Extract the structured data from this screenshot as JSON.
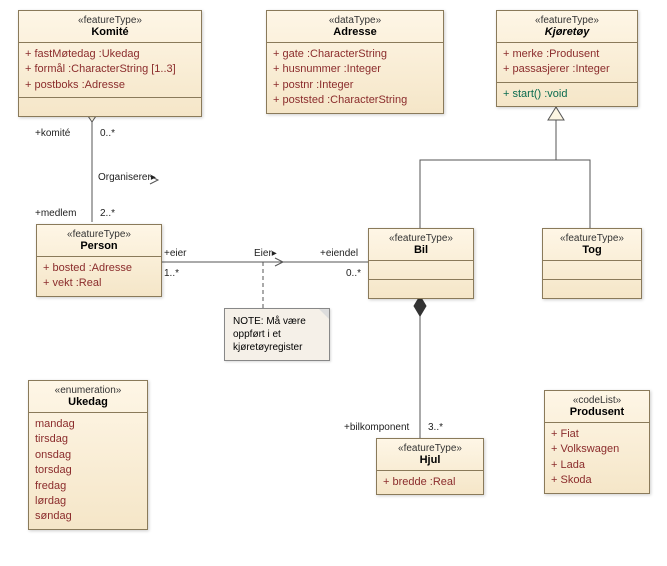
{
  "classes": {
    "komite": {
      "stereo": "«featureType»",
      "name": "Komité",
      "attrs": [
        "+  fastMøtedag :Ukedag",
        "+  formål :CharacterString [1..3]",
        "+  postboks :Adresse"
      ]
    },
    "adresse": {
      "stereo": "«dataType»",
      "name": "Adresse",
      "attrs": [
        "+  gate :CharacterString",
        "+  husnummer :Integer",
        "+  postnr :Integer",
        "+  poststed :CharacterString"
      ]
    },
    "kjoretoy": {
      "stereo": "«featureType»",
      "name": "Kjøretøy",
      "attrs": [
        "+  merke :Produsent",
        "+  passasjerer :Integer"
      ],
      "ops": [
        "+  start() :void"
      ]
    },
    "person": {
      "stereo": "«featureType»",
      "name": "Person",
      "attrs": [
        "+  bosted :Adresse",
        "+  vekt :Real"
      ]
    },
    "bil": {
      "stereo": "«featureType»",
      "name": "Bil"
    },
    "tog": {
      "stereo": "«featureType»",
      "name": "Tog"
    },
    "hjul": {
      "stereo": "«featureType»",
      "name": "Hjul",
      "attrs": [
        "+  bredde :Real"
      ]
    },
    "ukedag": {
      "stereo": "«enumeration»",
      "name": "Ukedag",
      "literals": [
        "mandag",
        "tirsdag",
        "onsdag",
        "torsdag",
        "fredag",
        "lørdag",
        "søndag"
      ]
    },
    "produsent": {
      "stereo": "«codeList»",
      "name": "Produsent",
      "attrs": [
        "+  Fiat",
        "+  Volkswagen",
        "+  Lada",
        "+  Skoda"
      ]
    }
  },
  "labels": {
    "komite_role": "+komité",
    "komite_mult": "0..*",
    "organiserer": "Organiserer",
    "medlem_role": "+medlem",
    "medlem_mult": "2..*",
    "eier_role": "+eier",
    "eier_mult": "1..*",
    "eier_assoc": "Eier",
    "eiendel_role": "+eiendel",
    "eiendel_mult": "0..*",
    "bilkomp_role": "+bilkomponent",
    "bilkomp_mult": "3..*"
  },
  "note": {
    "text": "NOTE: Må være oppført i et kjøretøyregister"
  },
  "chart_data": {
    "type": "uml_class_diagram",
    "classes": [
      {
        "name": "Komité",
        "stereotype": "featureType",
        "attributes": [
          {
            "name": "fastMøtedag",
            "type": "Ukedag",
            "visibility": "+"
          },
          {
            "name": "formål",
            "type": "CharacterString",
            "multiplicity": "1..3",
            "visibility": "+"
          },
          {
            "name": "postboks",
            "type": "Adresse",
            "visibility": "+"
          }
        ]
      },
      {
        "name": "Adresse",
        "stereotype": "dataType",
        "attributes": [
          {
            "name": "gate",
            "type": "CharacterString",
            "visibility": "+"
          },
          {
            "name": "husnummer",
            "type": "Integer",
            "visibility": "+"
          },
          {
            "name": "postnr",
            "type": "Integer",
            "visibility": "+"
          },
          {
            "name": "poststed",
            "type": "CharacterString",
            "visibility": "+"
          }
        ]
      },
      {
        "name": "Kjøretøy",
        "stereotype": "featureType",
        "abstract": true,
        "attributes": [
          {
            "name": "merke",
            "type": "Produsent",
            "visibility": "+"
          },
          {
            "name": "passasjerer",
            "type": "Integer",
            "visibility": "+"
          }
        ],
        "operations": [
          {
            "name": "start",
            "returns": "void",
            "visibility": "+"
          }
        ]
      },
      {
        "name": "Person",
        "stereotype": "featureType",
        "attributes": [
          {
            "name": "bosted",
            "type": "Adresse",
            "visibility": "+"
          },
          {
            "name": "vekt",
            "type": "Real",
            "visibility": "+"
          }
        ]
      },
      {
        "name": "Bil",
        "stereotype": "featureType"
      },
      {
        "name": "Tog",
        "stereotype": "featureType"
      },
      {
        "name": "Hjul",
        "stereotype": "featureType",
        "attributes": [
          {
            "name": "bredde",
            "type": "Real",
            "visibility": "+"
          }
        ]
      },
      {
        "name": "Ukedag",
        "stereotype": "enumeration",
        "literals": [
          "mandag",
          "tirsdag",
          "onsdag",
          "torsdag",
          "fredag",
          "lørdag",
          "søndag"
        ]
      },
      {
        "name": "Produsent",
        "stereotype": "codeList",
        "attributes": [
          {
            "name": "Fiat",
            "visibility": "+"
          },
          {
            "name": "Volkswagen",
            "visibility": "+"
          },
          {
            "name": "Lada",
            "visibility": "+"
          },
          {
            "name": "Skoda",
            "visibility": "+"
          }
        ]
      }
    ],
    "relationships": [
      {
        "type": "aggregation",
        "whole": "Komité",
        "part": "Person",
        "name": "Organiserer",
        "ends": [
          {
            "role": "komité",
            "multiplicity": "0..*",
            "at": "Komité"
          },
          {
            "role": "medlem",
            "multiplicity": "2..*",
            "at": "Person"
          }
        ]
      },
      {
        "type": "association",
        "name": "Eier",
        "ends": [
          {
            "role": "eier",
            "multiplicity": "1..*",
            "at": "Person"
          },
          {
            "role": "eiendel",
            "multiplicity": "0..*",
            "at": "Bil"
          }
        ],
        "note": "Må være oppført i et kjøretøyregister"
      },
      {
        "type": "composition",
        "whole": "Bil",
        "part": "Hjul",
        "ends": [
          {
            "role": "bilkomponent",
            "multiplicity": "3..*",
            "at": "Hjul"
          }
        ]
      },
      {
        "type": "generalization",
        "child": "Bil",
        "parent": "Kjøretøy"
      },
      {
        "type": "generalization",
        "child": "Tog",
        "parent": "Kjøretøy"
      }
    ]
  }
}
